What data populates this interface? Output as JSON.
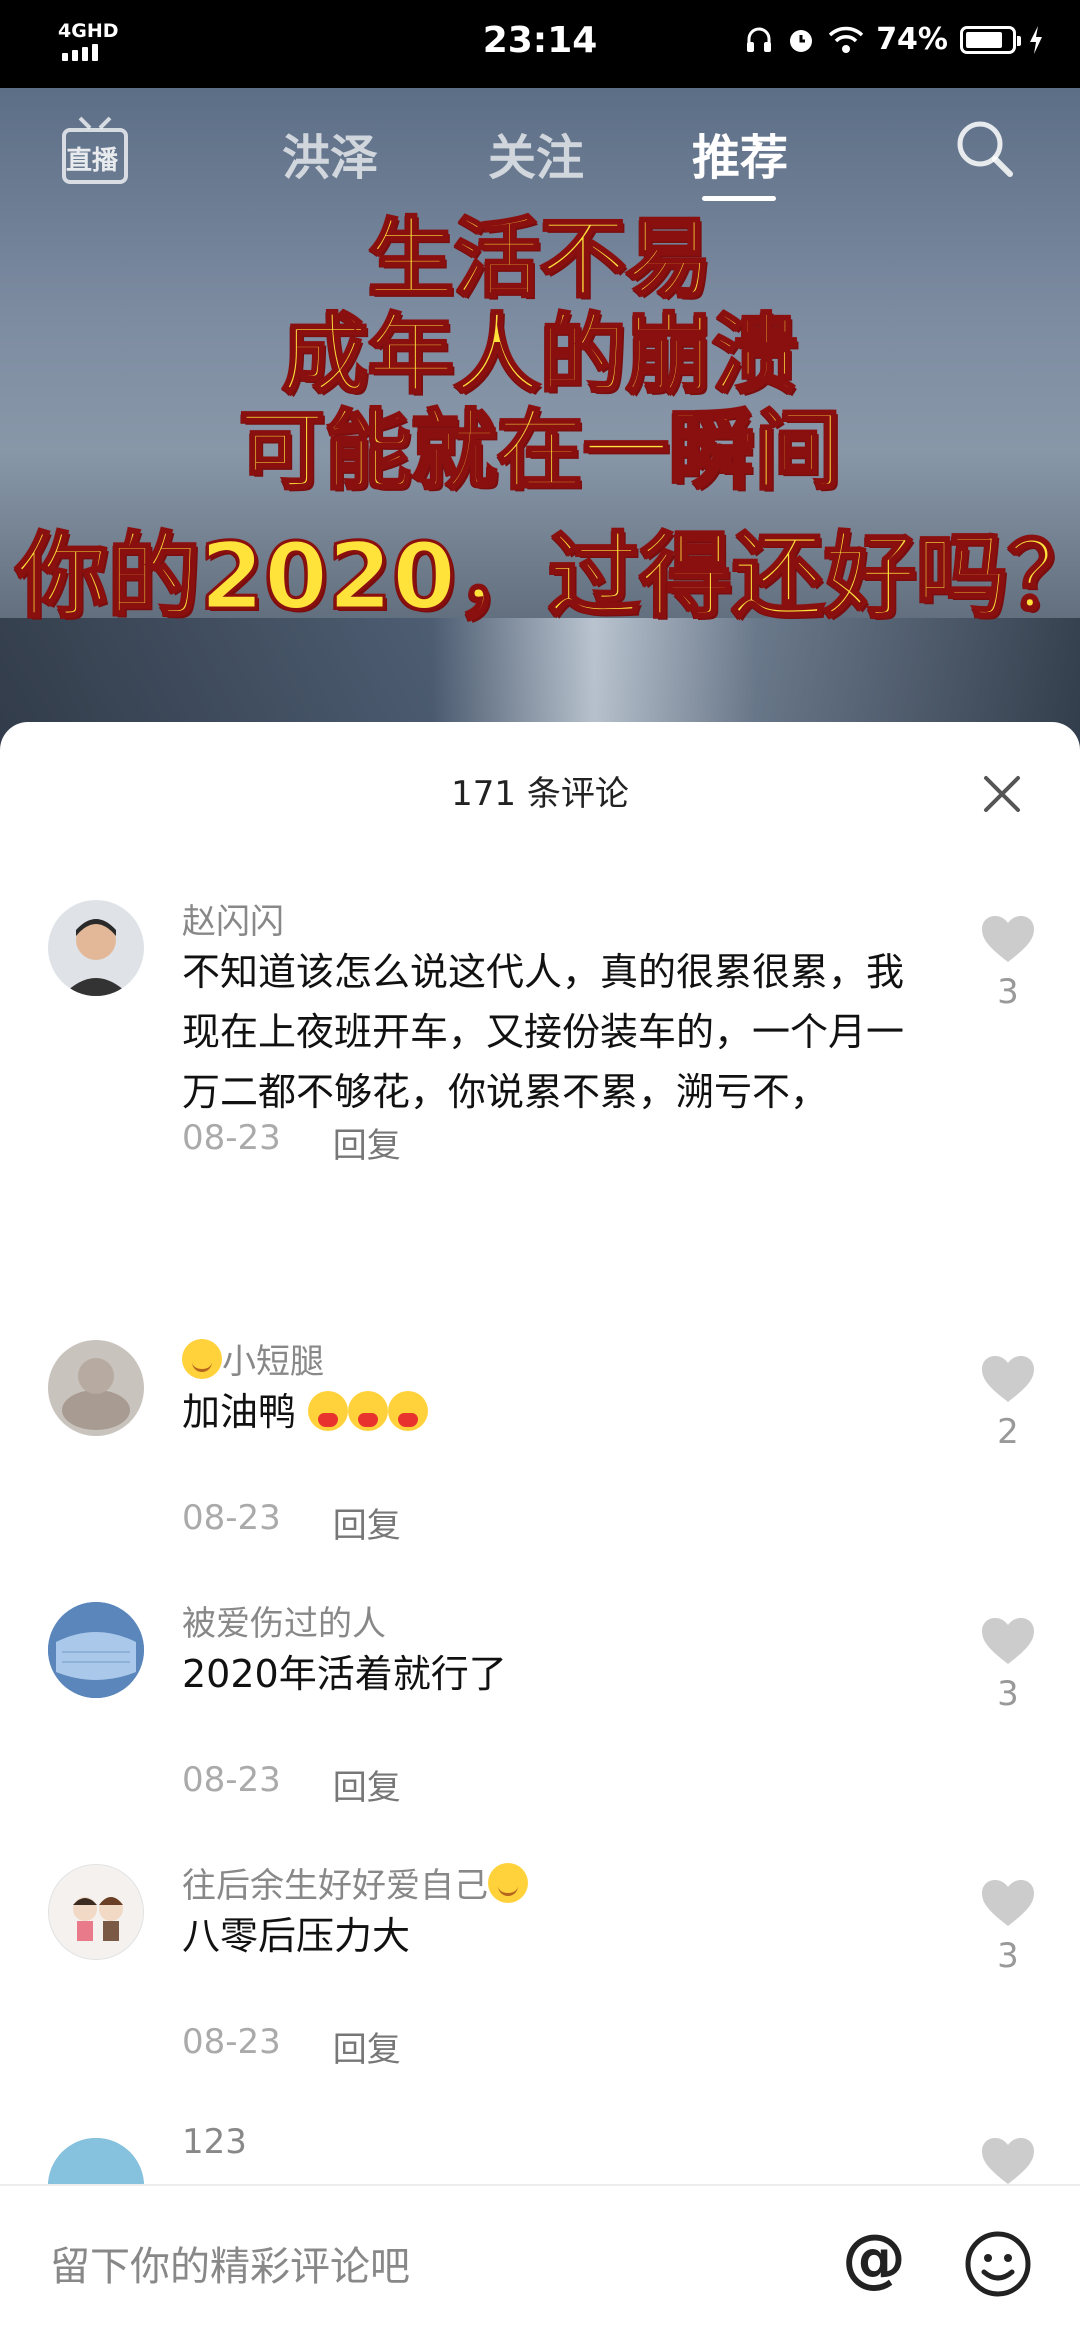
{
  "status_bar": {
    "network": "4GHD",
    "time": "23:14",
    "battery_percent": "74%"
  },
  "top_nav": {
    "live_label": "直播",
    "tabs": [
      "洪泽",
      "关注",
      "推荐"
    ],
    "active_tab": "推荐"
  },
  "video_overlay": {
    "lines": [
      "生活不易",
      "成年人的崩溃",
      "可能就在一瞬间",
      "你的2020，过得还好吗？"
    ]
  },
  "comments_sheet": {
    "title": "171 条评论",
    "comments": [
      {
        "name": "赵闪闪",
        "text": "不知道该怎么说这代人，真的很累很累，我现在上夜班开车，又接份装车的，一个月一万二都不够花，你说累不累，溯亏不，",
        "date": "08-23",
        "reply": "回复",
        "likes": "3"
      },
      {
        "name": "小短腿",
        "text": "加油鸭",
        "date": "08-23",
        "reply": "回复",
        "likes": "2"
      },
      {
        "name": "被爱伤过的人",
        "text": "2020年活着就行了",
        "date": "08-23",
        "reply": "回复",
        "likes": "3"
      },
      {
        "name": "往后余生好好爱自己",
        "text": "八零后压力大",
        "date": "08-23",
        "reply": "回复",
        "likes": "3"
      },
      {
        "name": "123",
        "text": "",
        "date": "",
        "reply": "",
        "likes": ""
      }
    ]
  },
  "input_bar": {
    "placeholder": "留下你的精彩评论吧",
    "at_symbol": "@"
  },
  "colors": {
    "overlay_text": "#ffe23a",
    "overlay_stroke": "#8a1010",
    "like_icon": "#cccccc"
  }
}
